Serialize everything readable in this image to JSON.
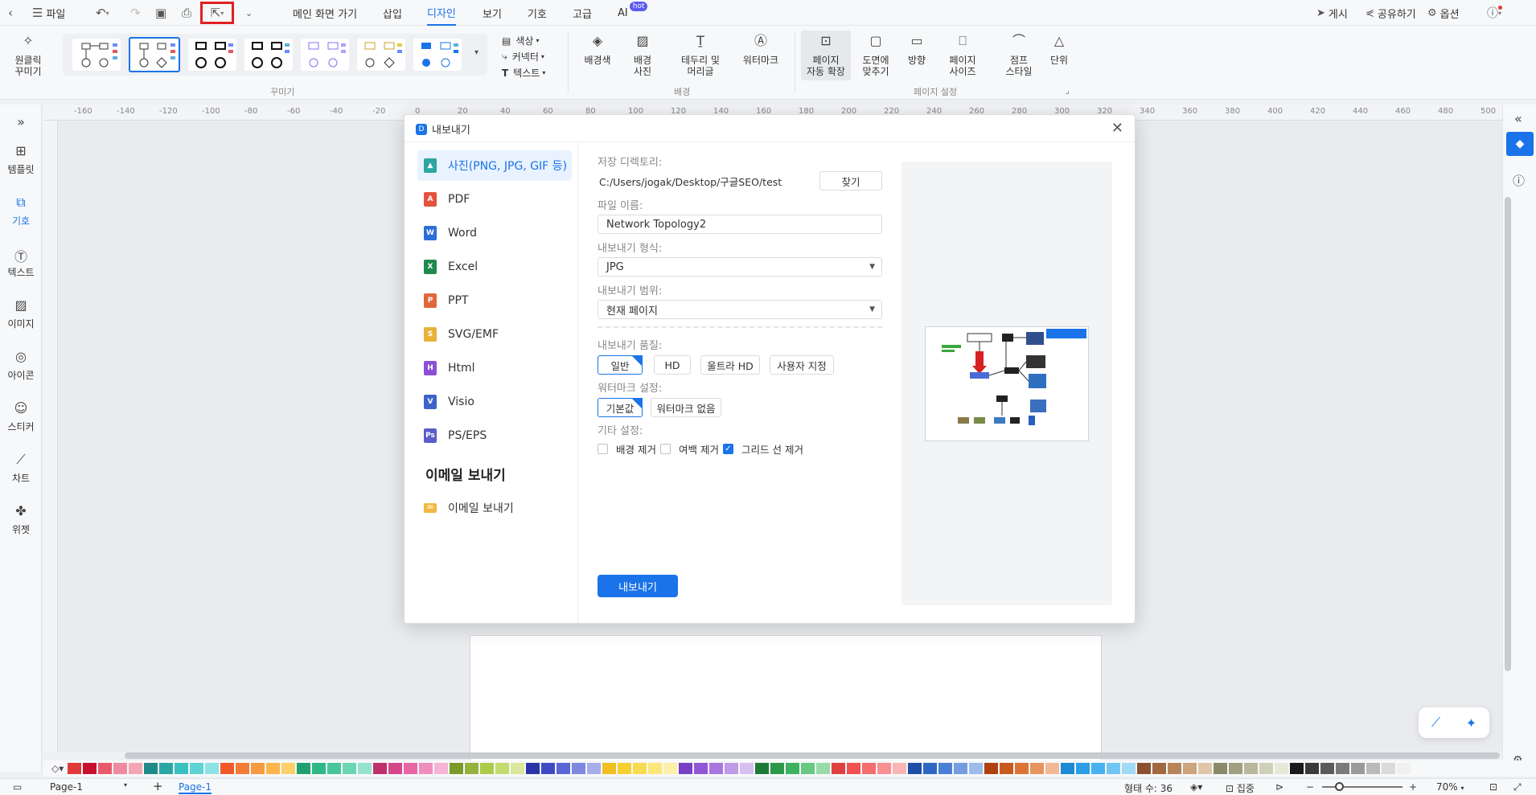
{
  "titlebar": {
    "file_label": "파일",
    "menu_tabs": [
      {
        "label": "메인 화면 가기"
      },
      {
        "label": "삽입"
      },
      {
        "label": "디자인",
        "active": true
      },
      {
        "label": "보기"
      },
      {
        "label": "기호"
      },
      {
        "label": "고급"
      },
      {
        "label": "AI",
        "badge": "hot"
      }
    ],
    "publish_label": "게시",
    "share_label": "공유하기",
    "options_label": "옵션"
  },
  "ribbon": {
    "oneclick_label": "원클릭\n꾸미기",
    "style_group_label": "꾸미기",
    "side_options": [
      "색상",
      "커넥터",
      "텍스트"
    ],
    "background_buttons": [
      "배경색",
      "배경\n사진",
      "테두리 및\n머리글",
      "워터마크"
    ],
    "background_group_label": "배경",
    "page_buttons": [
      "페이지\n자동 확장",
      "도면에\n맞추기",
      "방향",
      "페이지\n사이즈",
      "점프\n스타일",
      "단위"
    ],
    "page_group_label": "페이지 설정"
  },
  "ruler": {
    "ticks": [
      "-160",
      "-140",
      "-120",
      "-100",
      "-80",
      "-60",
      "-40",
      "-20",
      "0",
      "20",
      "40",
      "60",
      "80",
      "100",
      "120",
      "140",
      "160",
      "180",
      "200",
      "220",
      "240",
      "260",
      "280",
      "300",
      "320",
      "340",
      "360",
      "380",
      "400",
      "420",
      "440",
      "460",
      "480",
      "500"
    ]
  },
  "leftbar": {
    "items": [
      {
        "label": "템플릿",
        "icon": "template-icon"
      },
      {
        "label": "기호",
        "icon": "symbol-icon",
        "active": true
      },
      {
        "label": "텍스트",
        "icon": "text-icon"
      },
      {
        "label": "이미지",
        "icon": "image-icon"
      },
      {
        "label": "아이콘",
        "icon": "icon-icon"
      },
      {
        "label": "스티커",
        "icon": "sticker-icon"
      },
      {
        "label": "차트",
        "icon": "chart-icon"
      },
      {
        "label": "위젯",
        "icon": "widget-icon"
      }
    ]
  },
  "dialog": {
    "title": "내보내기",
    "formats": [
      {
        "label": "사진(PNG, JPG, GIF 등)",
        "color": "#2ba6a0",
        "active": true
      },
      {
        "label": "PDF",
        "color": "#e5533d"
      },
      {
        "label": "Word",
        "color": "#2b6fd6"
      },
      {
        "label": "Excel",
        "color": "#1e8a4c"
      },
      {
        "label": "PPT",
        "color": "#e0673a"
      },
      {
        "label": "SVG/EMF",
        "color": "#e8b23a"
      },
      {
        "label": "Html",
        "color": "#8e4fd6"
      },
      {
        "label": "Visio",
        "color": "#3b63c9"
      },
      {
        "label": "PS/EPS",
        "color": "#5c5cc9"
      }
    ],
    "email_heading": "이메일 보내기",
    "email_item": "이메일 보내기",
    "save_dir_label": "저장 디렉토리:",
    "save_dir_value": "C:/Users/jogak/Desktop/구글SEO/test",
    "browse_label": "찾기",
    "filename_label": "파일 이름:",
    "filename_value": "Network Topology2",
    "format_label": "내보내기 형식:",
    "format_value": "JPG",
    "range_label": "내보내기 범위:",
    "range_value": "현재 페이지",
    "quality_label": "내보내기 품질:",
    "quality_options": [
      "일반",
      "HD",
      "울트라 HD",
      "사용자 지정"
    ],
    "watermark_label": "워터마크 설정:",
    "watermark_options": [
      "기본값",
      "워터마크 없음"
    ],
    "other_label": "기타 설정:",
    "other_options": [
      {
        "label": "배경 제거",
        "checked": false
      },
      {
        "label": "여백 제거",
        "checked": false
      },
      {
        "label": "그리드 선 제거",
        "checked": true
      }
    ],
    "export_button": "내보내기"
  },
  "palette": [
    "#e03b3b",
    "#c8102e",
    "#e85a6b",
    "#f08aa0",
    "#f4a6b5",
    "#1f8a8a",
    "#2aa6a6",
    "#3bc0c0",
    "#5fd3d3",
    "#8ce3e3",
    "#f05a28",
    "#f57c35",
    "#f89a40",
    "#fbb54a",
    "#fdd06a",
    "#20a070",
    "#2fb887",
    "#46c79b",
    "#6ad6b3",
    "#95e3cc",
    "#c0306a",
    "#d6478a",
    "#e866a4",
    "#f08dbf",
    "#f5b3d5",
    "#7a9a2a",
    "#94b33a",
    "#aacc4a",
    "#c2db6e",
    "#d9e89a",
    "#2a34a8",
    "#3f4bc4",
    "#5a66d6",
    "#7e88e0",
    "#a6adea",
    "#f0c020",
    "#f5d030",
    "#f8dc50",
    "#fbe67a",
    "#fdf0a6",
    "#7a3fc4",
    "#9157d6",
    "#a876e0",
    "#c099ea",
    "#d8bff2",
    "#1f7a3a",
    "#2a9a4a",
    "#3db35f",
    "#66c882",
    "#97dca8",
    "#e04040",
    "#f05050",
    "#f46e6e",
    "#f89090",
    "#fbb5b5",
    "#1e4fa8",
    "#2f66c4",
    "#4a80d6",
    "#729ee0",
    "#9cbdea",
    "#b04010",
    "#c85a20",
    "#dc7438",
    "#e8945e",
    "#f2b896",
    "#1a8ad6",
    "#2a9ee6",
    "#48b2ee",
    "#72c6f2",
    "#a0daf6",
    "#8a5030",
    "#a0683e",
    "#b8845a",
    "#cca47e",
    "#e0c6a8",
    "#8a8a6a",
    "#a0a080",
    "#b8b89a",
    "#d0d0b8",
    "#e8e8d6",
    "#1a1a1a",
    "#3a3a3a",
    "#5a5a5a",
    "#7a7a7a",
    "#9a9a9a",
    "#bababa",
    "#dadada",
    "#f0f0f0"
  ],
  "status": {
    "page_selector": "Page-1",
    "page_tab": "Page-1",
    "shape_count": "형태 수: 36",
    "focus_label": "집중",
    "zoom": "70%"
  }
}
